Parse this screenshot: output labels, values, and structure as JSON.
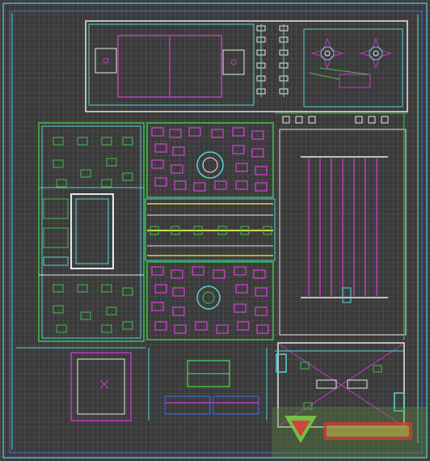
{
  "drawing": {
    "type": "cad-site-plan",
    "background": "#3a3a3a",
    "palette": {
      "grid": "#7e7e7e",
      "border": "#4fb3c9",
      "walls": "#e8e8e8",
      "paving": "#c03cc0",
      "planting": "#3fc24a",
      "paths": "#52d6d6",
      "accent_yellow": "#d8d84a",
      "accent_blue": "#3a6cf0"
    },
    "zones": [
      {
        "name": "north-pavilion-court"
      },
      {
        "name": "northeast-planting-court"
      },
      {
        "name": "west-courtyard"
      },
      {
        "name": "central-plaza-north"
      },
      {
        "name": "central-walkway"
      },
      {
        "name": "central-plaza-south"
      },
      {
        "name": "east-pergola"
      },
      {
        "name": "southwest-pavilion"
      },
      {
        "name": "south-entrance"
      },
      {
        "name": "southeast-court"
      }
    ]
  },
  "watermark": {
    "logo_icon": "site-logo-icon",
    "text": "",
    "colors": {
      "green": "#7ad04a",
      "red": "#d83a3a"
    }
  }
}
